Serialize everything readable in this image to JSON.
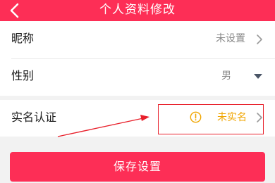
{
  "header": {
    "title": "个人资料修改",
    "back_icon": "chevron-left-icon"
  },
  "rows": [
    {
      "label": "昵称",
      "value": "未设置",
      "icon": "chevron-right-icon"
    },
    {
      "label": "性别",
      "value": "男",
      "icon": "caret-down-icon"
    }
  ],
  "realname": {
    "label": "实名认证",
    "value": "未实名",
    "status_icon": "warning-circle-icon",
    "icon": "chevron-right-icon"
  },
  "save_button": {
    "label": "保存设置"
  },
  "colors": {
    "brand": "#fd2e56",
    "warning": "#f0a500",
    "annotation": "#e8202b"
  }
}
